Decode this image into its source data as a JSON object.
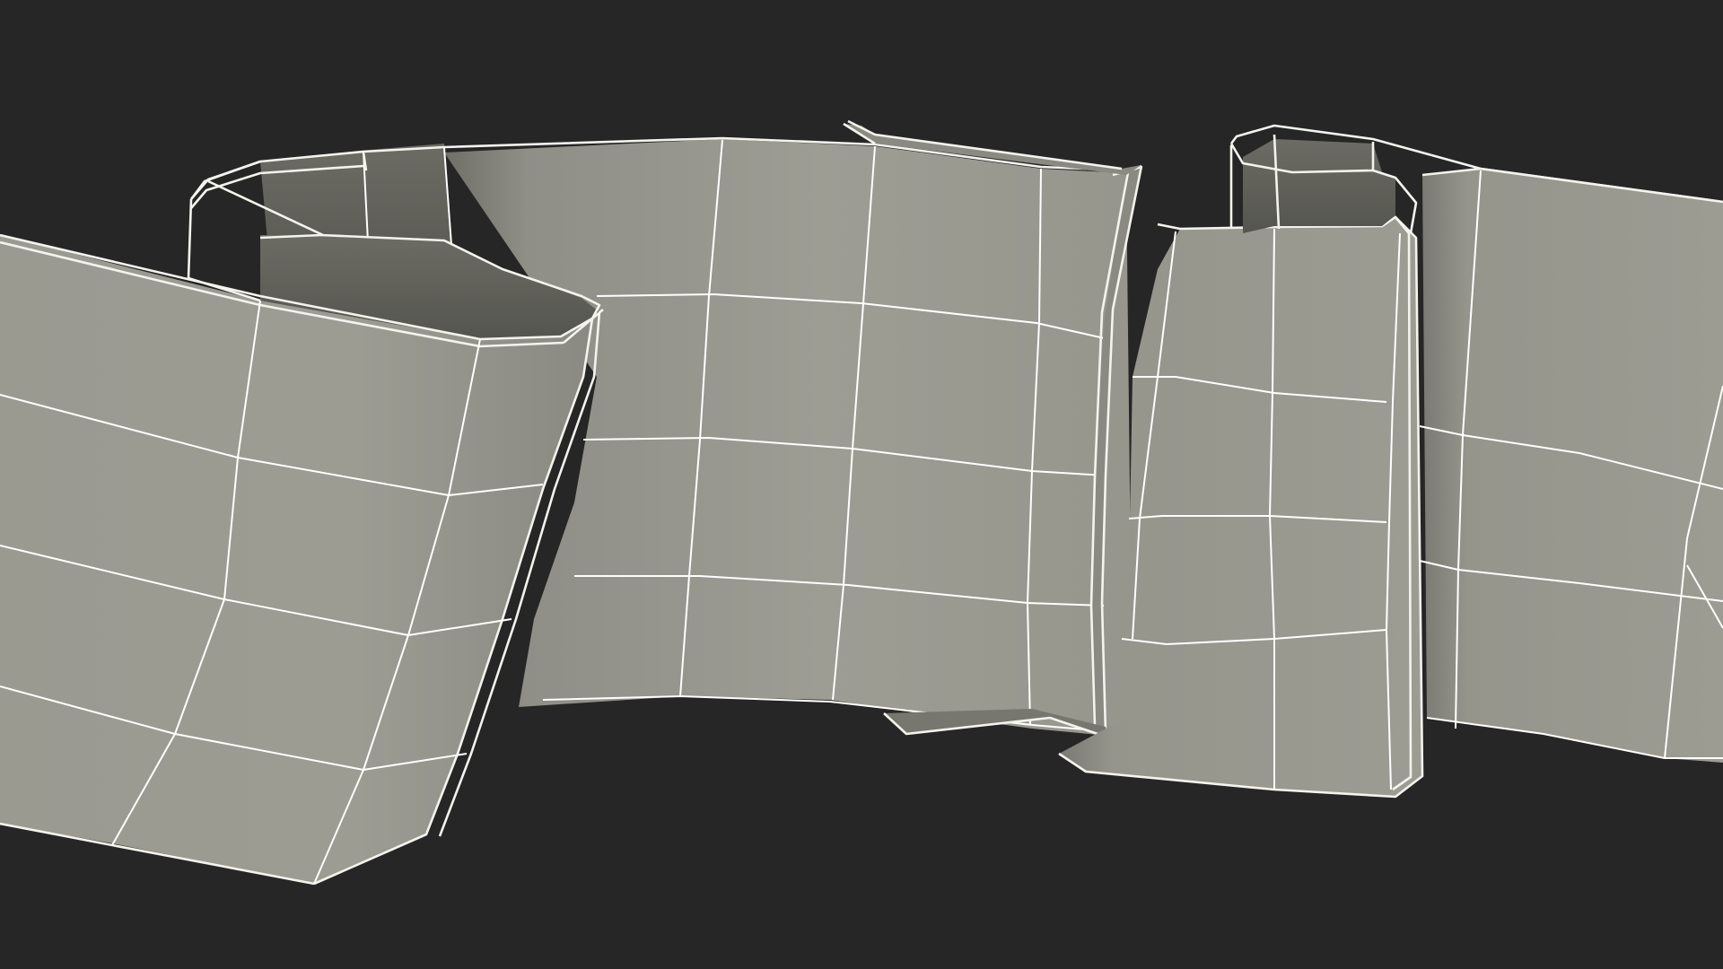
{
  "scene": {
    "background_color": "#262626",
    "surface_color": "#9c9c93",
    "surface_shadow_color": "#66665f",
    "wireframe_color": "#ffffff",
    "subject": "ribbon-banner-wireframe-model"
  }
}
